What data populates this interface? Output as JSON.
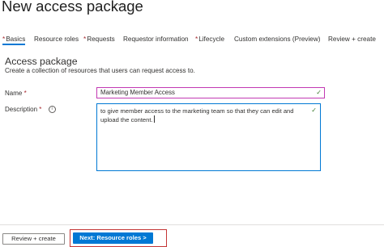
{
  "header": {
    "title": "New access package",
    "more_glyph": "···"
  },
  "tabs": [
    {
      "label": "Basics",
      "required": true,
      "active": true
    },
    {
      "label": "Resource roles",
      "required": false
    },
    {
      "label": "Requests",
      "required": true
    },
    {
      "label": "Requestor information",
      "required": false
    },
    {
      "label": "Lifecycle",
      "required": true
    },
    {
      "label": "Custom extensions (Preview)",
      "required": false
    },
    {
      "label": "Review + create",
      "required": false
    }
  ],
  "section": {
    "title": "Access package",
    "description": "Create a collection of resources that users can request access to."
  },
  "form": {
    "name_label": "Name",
    "name_value": "Marketing Member Access",
    "description_label": "Description",
    "description_value": "to give member access to the marketing team so that they can edit and upload the content."
  },
  "footer": {
    "prev_label": "Review + create",
    "next_label": "Next: Resource roles >"
  },
  "colors": {
    "accent": "#0078d4",
    "required": "#a4262c",
    "highlight": "#c43535"
  },
  "icons": [
    "more-icon",
    "info-icon",
    "check-icon"
  ]
}
